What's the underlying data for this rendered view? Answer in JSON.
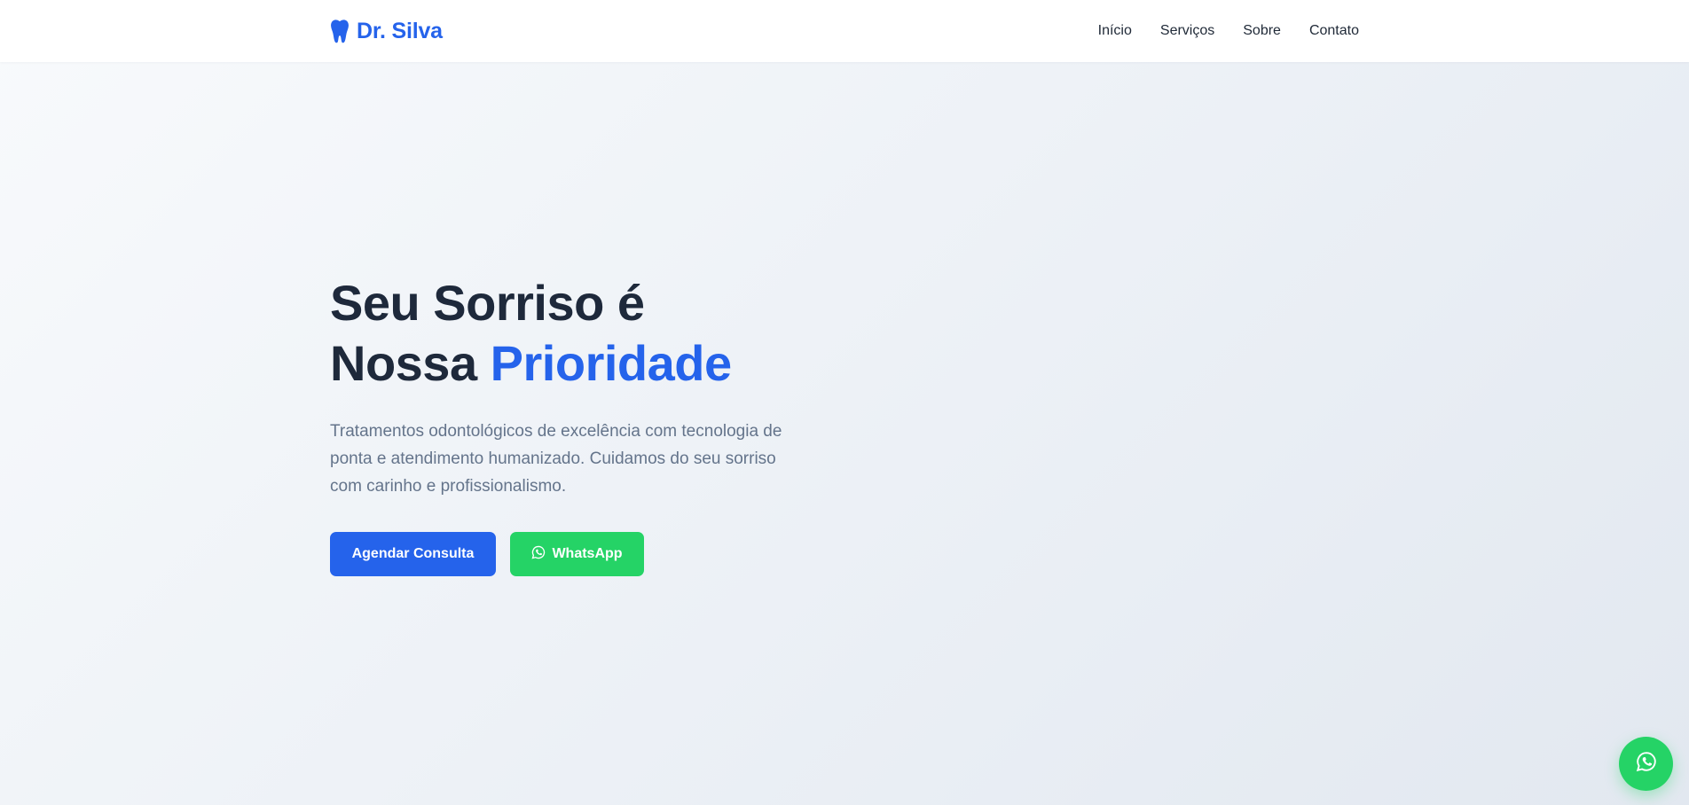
{
  "brand": {
    "name": "Dr. Silva",
    "icon": "tooth-icon",
    "color": "#2563eb"
  },
  "nav": {
    "items": [
      {
        "label": "Início"
      },
      {
        "label": "Serviços"
      },
      {
        "label": "Sobre"
      },
      {
        "label": "Contato"
      }
    ]
  },
  "hero": {
    "title_line1": "Seu Sorriso é",
    "title_line2_prefix": "Nossa",
    "title_line2_accent": "Prioridade",
    "description": "Tratamentos odontológicos de excelência com tecnologia de ponta e atendimento humanizado. Cuidamos do seu sorriso com carinho e profissionalismo.",
    "primary_button": "Agendar Consulta",
    "whatsapp_button": "WhatsApp"
  },
  "floating_button": {
    "icon": "whatsapp-icon"
  },
  "colors": {
    "primary": "#2563eb",
    "whatsapp": "#25d366",
    "heading": "#1e293b",
    "body_text": "#64748b"
  }
}
